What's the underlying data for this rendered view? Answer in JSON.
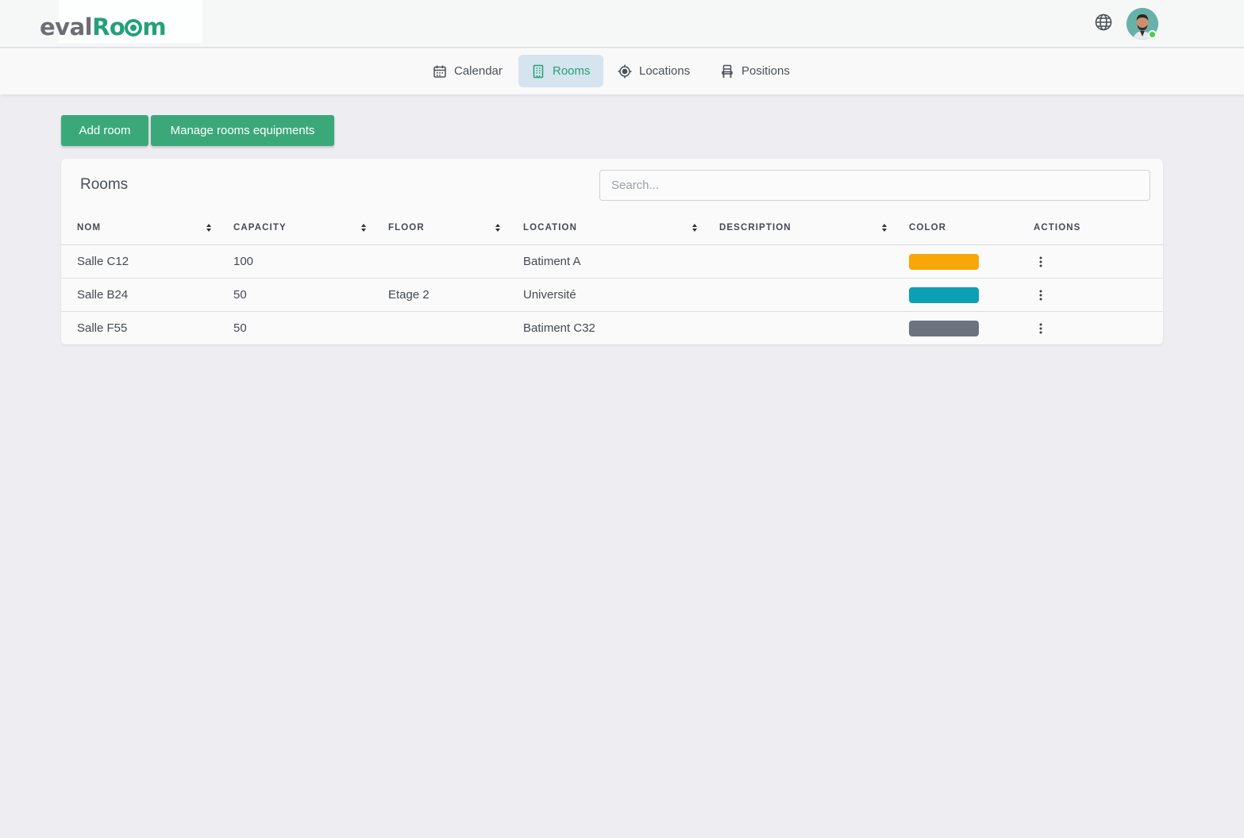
{
  "header": {
    "logo": {
      "part1": "eval",
      "part2": "R",
      "part3": "m"
    },
    "language_icon": "globe-icon",
    "avatar_status": "online"
  },
  "nav": {
    "items": [
      {
        "label": "Calendar",
        "icon": "calendar-icon",
        "active": false
      },
      {
        "label": "Rooms",
        "icon": "building-icon",
        "active": true
      },
      {
        "label": "Locations",
        "icon": "crosshair-icon",
        "active": false
      },
      {
        "label": "Positions",
        "icon": "chair-icon",
        "active": false
      }
    ]
  },
  "actions": {
    "add_room": "Add room",
    "manage_equipments": "Manage rooms equipments"
  },
  "rooms_card": {
    "title": "Rooms",
    "search_placeholder": "Search...",
    "columns": [
      "Nom",
      "Capacity",
      "Floor",
      "Location",
      "Description",
      "Color",
      "Actions"
    ],
    "rows": [
      {
        "nom": "Salle C12",
        "capacity": "100",
        "floor": "",
        "location": "Batiment A",
        "description": "",
        "color": "#f8a708"
      },
      {
        "nom": "Salle B24",
        "capacity": "50",
        "floor": "Etage 2",
        "location": "Université",
        "description": "",
        "color": "#0d9fb4"
      },
      {
        "nom": "Salle F55",
        "capacity": "50",
        "floor": "",
        "location": "Batiment C32",
        "description": "",
        "color": "#6c737e"
      }
    ]
  },
  "colors": {
    "accent": "#3ba87a",
    "active_nav_bg": "#d5e4ee",
    "page_bg": "#eeedf2"
  }
}
